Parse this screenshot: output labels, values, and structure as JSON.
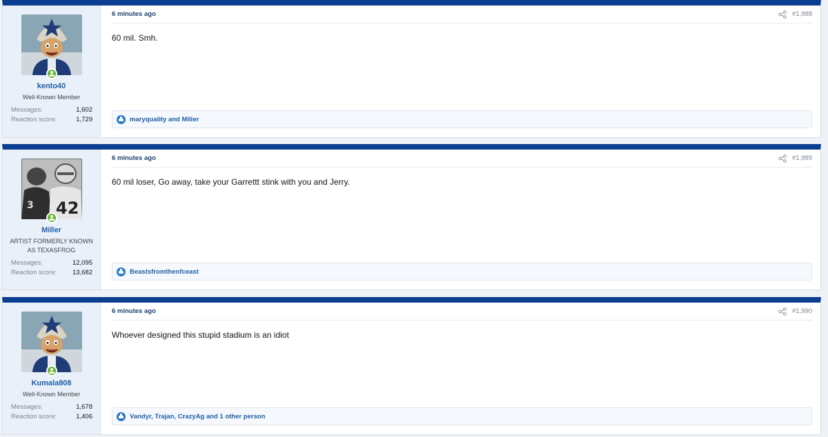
{
  "posts": [
    {
      "username": "kento40",
      "user_title": "Well-Known Member",
      "messages_label": "Messages:",
      "messages_value": "1,602",
      "reaction_label": "Reaction score:",
      "reaction_value": "1,729",
      "time": "6 minutes ago",
      "post_number": "#1,988",
      "body": "60 mil. Smh.",
      "reactions": "maryquality and Miller",
      "avatar": "star-helmet-mascot-avatar"
    },
    {
      "username": "Miller",
      "user_title": "ARTIST FORMERLY KNOWN AS TEXASFROG",
      "messages_label": "Messages:",
      "messages_value": "12,095",
      "reaction_label": "Reaction score:",
      "reaction_value": "13,682",
      "time": "6 minutes ago",
      "post_number": "#1,989",
      "body": "60 mil loser, Go away, take your Garrettt stink with you and Jerry.",
      "reactions": "Beastsfromthenfceast",
      "avatar": "football-players-photo-avatar"
    },
    {
      "username": "Kumala808",
      "user_title": "Well-Known Member",
      "messages_label": "Messages:",
      "messages_value": "1,678",
      "reaction_label": "Reaction score:",
      "reaction_value": "1,406",
      "time": "6 minutes ago",
      "post_number": "#1,990",
      "body": "Whoever designed this stupid stadium is an idiot",
      "reactions": "Vandyr, Trajan, CrazyAg and 1 other person",
      "avatar": "star-helmet-mascot-avatar"
    }
  ],
  "colors": {
    "header_bar": "#0b3d91",
    "user_cell_bg": "#e9f0f9",
    "link": "#1d5fa5",
    "online": "#63b32c"
  }
}
